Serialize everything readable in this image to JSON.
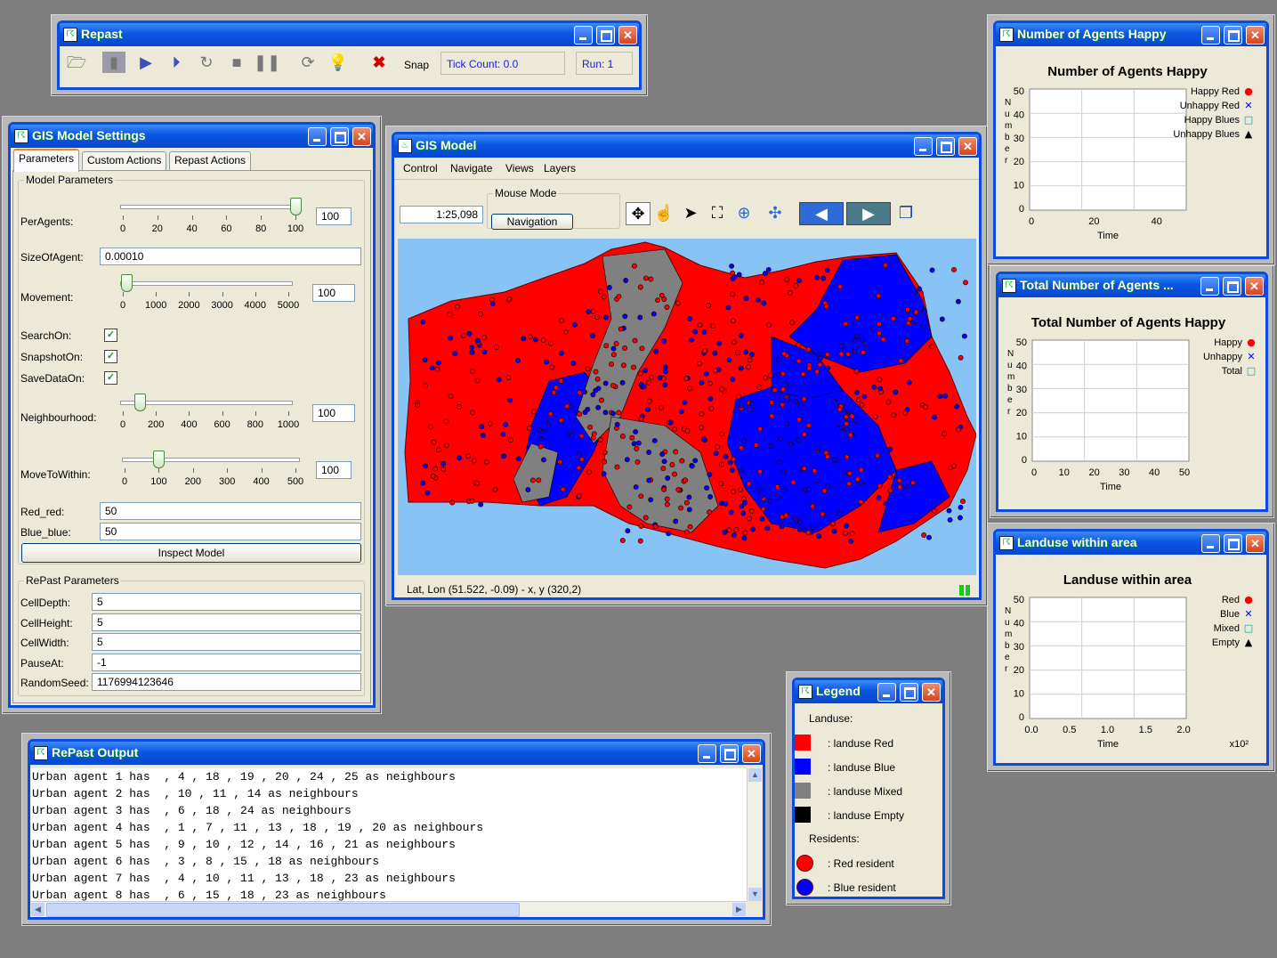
{
  "repast": {
    "title": "Repast",
    "snap_label": "Snap",
    "tick_count": "Tick Count: 0.0",
    "run": "Run: 1"
  },
  "settings": {
    "title": "GIS Model Settings",
    "tabs": [
      "Parameters",
      "Custom Actions",
      "Repast Actions"
    ],
    "model_group": "Model Parameters",
    "per_agents": {
      "label": "PerAgents:",
      "value": "100",
      "ticks": [
        "0",
        "20",
        "40",
        "60",
        "80",
        "100"
      ],
      "position": 1.0
    },
    "size_of_agent": {
      "label": "SizeOfAgent:",
      "value": "0.00010"
    },
    "movement": {
      "label": "Movement:",
      "value": "100",
      "ticks": [
        "0",
        "1000",
        "2000",
        "3000",
        "4000",
        "5000"
      ],
      "position": 0.02
    },
    "search_on": {
      "label": "SearchOn:",
      "checked": true
    },
    "snapshot_on": {
      "label": "SnapshotOn:",
      "checked": true
    },
    "save_data_on": {
      "label": "SaveDataOn:",
      "checked": true
    },
    "neighbourhood": {
      "label": "Neighbourhood:",
      "value": "100",
      "ticks": [
        "0",
        "200",
        "400",
        "600",
        "800",
        "1000"
      ],
      "position": 0.1
    },
    "move_to_within": {
      "label": "MoveToWithin:",
      "value": "100",
      "ticks": [
        "0",
        "100",
        "200",
        "300",
        "400",
        "500"
      ],
      "position": 0.2
    },
    "red_red": {
      "label": "Red_red:",
      "value": "50"
    },
    "blue_blue": {
      "label": "Blue_blue:",
      "value": "50"
    },
    "inspect_button": "Inspect Model",
    "repast_group": "RePast Parameters",
    "cell_depth": {
      "label": "CellDepth:",
      "value": "5"
    },
    "cell_height": {
      "label": "CellHeight:",
      "value": "5"
    },
    "cell_width": {
      "label": "CellWidth:",
      "value": "5"
    },
    "pause_at": {
      "label": "PauseAt:",
      "value": "-1"
    },
    "random_seed": {
      "label": "RandomSeed:",
      "value": "1176994123646"
    }
  },
  "gis": {
    "title": "GIS Model",
    "menu": [
      "Control",
      "Navigate",
      "Views",
      "Layers"
    ],
    "scale": "1:25,098",
    "mouse_mode_label": "Mouse Mode",
    "mouse_mode_button": "Navigation",
    "status": "Lat, Lon (51.522, -0.09) - x, y (320,2)",
    "colors": {
      "red": "#ff0000",
      "blue": "#0000ff",
      "mixed": "#808080",
      "water": "#87c3f5"
    }
  },
  "charts": [
    {
      "window_title": "Number of Agents Happy",
      "title": "Number of Agents Happy",
      "ylabel": "Number",
      "xlabel": "Time",
      "yticks": [
        "0",
        "10",
        "20",
        "30",
        "40",
        "50"
      ],
      "xticks": [
        "0",
        "20",
        "40"
      ],
      "xticks_pos": [
        0,
        0.4,
        0.8
      ],
      "legend": [
        {
          "name": "Happy Red",
          "mark": "●",
          "color": "#ff0000"
        },
        {
          "name": "Unhappy Red",
          "mark": "✕",
          "color": "#0000ff"
        },
        {
          "name": "Happy Blues",
          "mark": "□",
          "color": "#00a0a0"
        },
        {
          "name": "Unhappy Blues",
          "mark": "▲",
          "color": "#000000"
        }
      ]
    },
    {
      "window_title": "Total Number of Agents ...",
      "title": "Total Number of Agents Happy",
      "ylabel": "Number",
      "xlabel": "Time",
      "yticks": [
        "0",
        "10",
        "20",
        "30",
        "40",
        "50"
      ],
      "xticks": [
        "0",
        "10",
        "20",
        "30",
        "40",
        "50"
      ],
      "xticks_pos": [
        0,
        0.192,
        0.384,
        0.576,
        0.768,
        0.96
      ],
      "legend": [
        {
          "name": "Happy",
          "mark": "●",
          "color": "#ff0000"
        },
        {
          "name": "Unhappy",
          "mark": "✕",
          "color": "#0000ff"
        },
        {
          "name": "Total",
          "mark": "□",
          "color": "#00a0a0"
        }
      ]
    },
    {
      "window_title": "Landuse within area",
      "title": "Landuse within area",
      "ylabel": "Number",
      "xlabel": "Time",
      "xunit": "x10²",
      "yticks": [
        "0",
        "10",
        "20",
        "30",
        "40",
        "50"
      ],
      "xticks": [
        "0.0",
        "0.5",
        "1.0",
        "1.5",
        "2.0"
      ],
      "xticks_pos": [
        0,
        0.243,
        0.486,
        0.729,
        0.972
      ],
      "legend": [
        {
          "name": "Red",
          "mark": "●",
          "color": "#ff0000"
        },
        {
          "name": "Blue",
          "mark": "✕",
          "color": "#0000ff"
        },
        {
          "name": "Mixed",
          "mark": "□",
          "color": "#00a0a0"
        },
        {
          "name": "Empty",
          "mark": "▲",
          "color": "#000000"
        }
      ]
    }
  ],
  "legend_window": {
    "title": "Legend",
    "landuse_heading": "Landuse:",
    "residents_heading": "Residents:",
    "landuse": [
      {
        "label": ": landuse Red",
        "color": "#ff0000"
      },
      {
        "label": ": landuse Blue",
        "color": "#0000ff"
      },
      {
        "label": ": landuse Mixed",
        "color": "#808080"
      },
      {
        "label": ": landuse Empty",
        "color": "#000000"
      }
    ],
    "residents": [
      {
        "label": ": Red resident",
        "color": "#ff0000"
      },
      {
        "label": ": Blue resident",
        "color": "#0000ff"
      }
    ]
  },
  "output": {
    "title": "RePast Output",
    "lines": [
      "Urban agent 1 has  , 4 , 18 , 19 , 20 , 24 , 25 as neighbours",
      "Urban agent 2 has  , 10 , 11 , 14 as neighbours",
      "Urban agent 3 has  , 6 , 18 , 24 as neighbours",
      "Urban agent 4 has  , 1 , 7 , 11 , 13 , 18 , 19 , 20 as neighbours",
      "Urban agent 5 has  , 9 , 10 , 12 , 14 , 16 , 21 as neighbours",
      "Urban agent 6 has  , 3 , 8 , 15 , 18 as neighbours",
      "Urban agent 7 has  , 4 , 10 , 11 , 13 , 18 , 23 as neighbours",
      "Urban agent 8 has  , 6 , 15 , 18 , 23 as neighbours"
    ]
  }
}
